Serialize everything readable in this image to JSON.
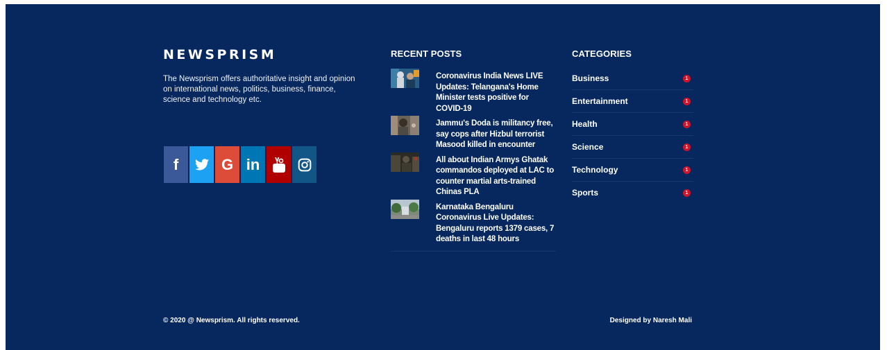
{
  "brand": {
    "name": "NEWSPRISM",
    "description": "The Newsprism offers authoritative insight and opinion on international news, politics, business, finance, science and technology etc."
  },
  "social": [
    {
      "name": "facebook",
      "glyph": "f",
      "color": "#3b5998",
      "icon": "facebook-icon"
    },
    {
      "name": "twitter",
      "glyph": "",
      "color": "#1da1f2",
      "icon": "twitter-icon"
    },
    {
      "name": "google",
      "glyph": "G",
      "color": "#dd4b39",
      "icon": "google-icon"
    },
    {
      "name": "linkedin",
      "glyph": "in",
      "color": "#0077b5",
      "icon": "linkedin-icon"
    },
    {
      "name": "youtube",
      "glyph": "",
      "color": "#b00000",
      "icon": "youtube-icon"
    },
    {
      "name": "instagram",
      "glyph": "",
      "color": "#125688",
      "icon": "instagram-icon"
    }
  ],
  "recent_posts": {
    "title": "RECENT POSTS",
    "items": [
      {
        "title": "Coronavirus India News LIVE Updates: Telangana's Home Minister tests positive for COVID-19"
      },
      {
        "title": "Jammu's Doda is militancy free, say cops after Hizbul terrorist Masood killed in encounter"
      },
      {
        "title": "All about Indian Armys Ghatak commandos deployed at LAC to counter martial arts-trained Chinas PLA"
      },
      {
        "title": "Karnataka Bengaluru Coronavirus Live Updates: Bengaluru reports 1379 cases, 7 deaths in last 48 hours"
      }
    ]
  },
  "categories": {
    "title": "CATEGORIES",
    "items": [
      {
        "label": "Business",
        "count": "1"
      },
      {
        "label": "Entertainment",
        "count": "1"
      },
      {
        "label": "Health",
        "count": "1"
      },
      {
        "label": "Science",
        "count": "1"
      },
      {
        "label": "Technology",
        "count": "1"
      },
      {
        "label": "Sports",
        "count": "1"
      }
    ]
  },
  "footer": {
    "copyright": "© 2020 @ Newsprism. All rights reserved.",
    "credit": "Designed by Naresh Mali"
  },
  "colors": {
    "background": "#06285e",
    "badge": "#d2142a"
  }
}
